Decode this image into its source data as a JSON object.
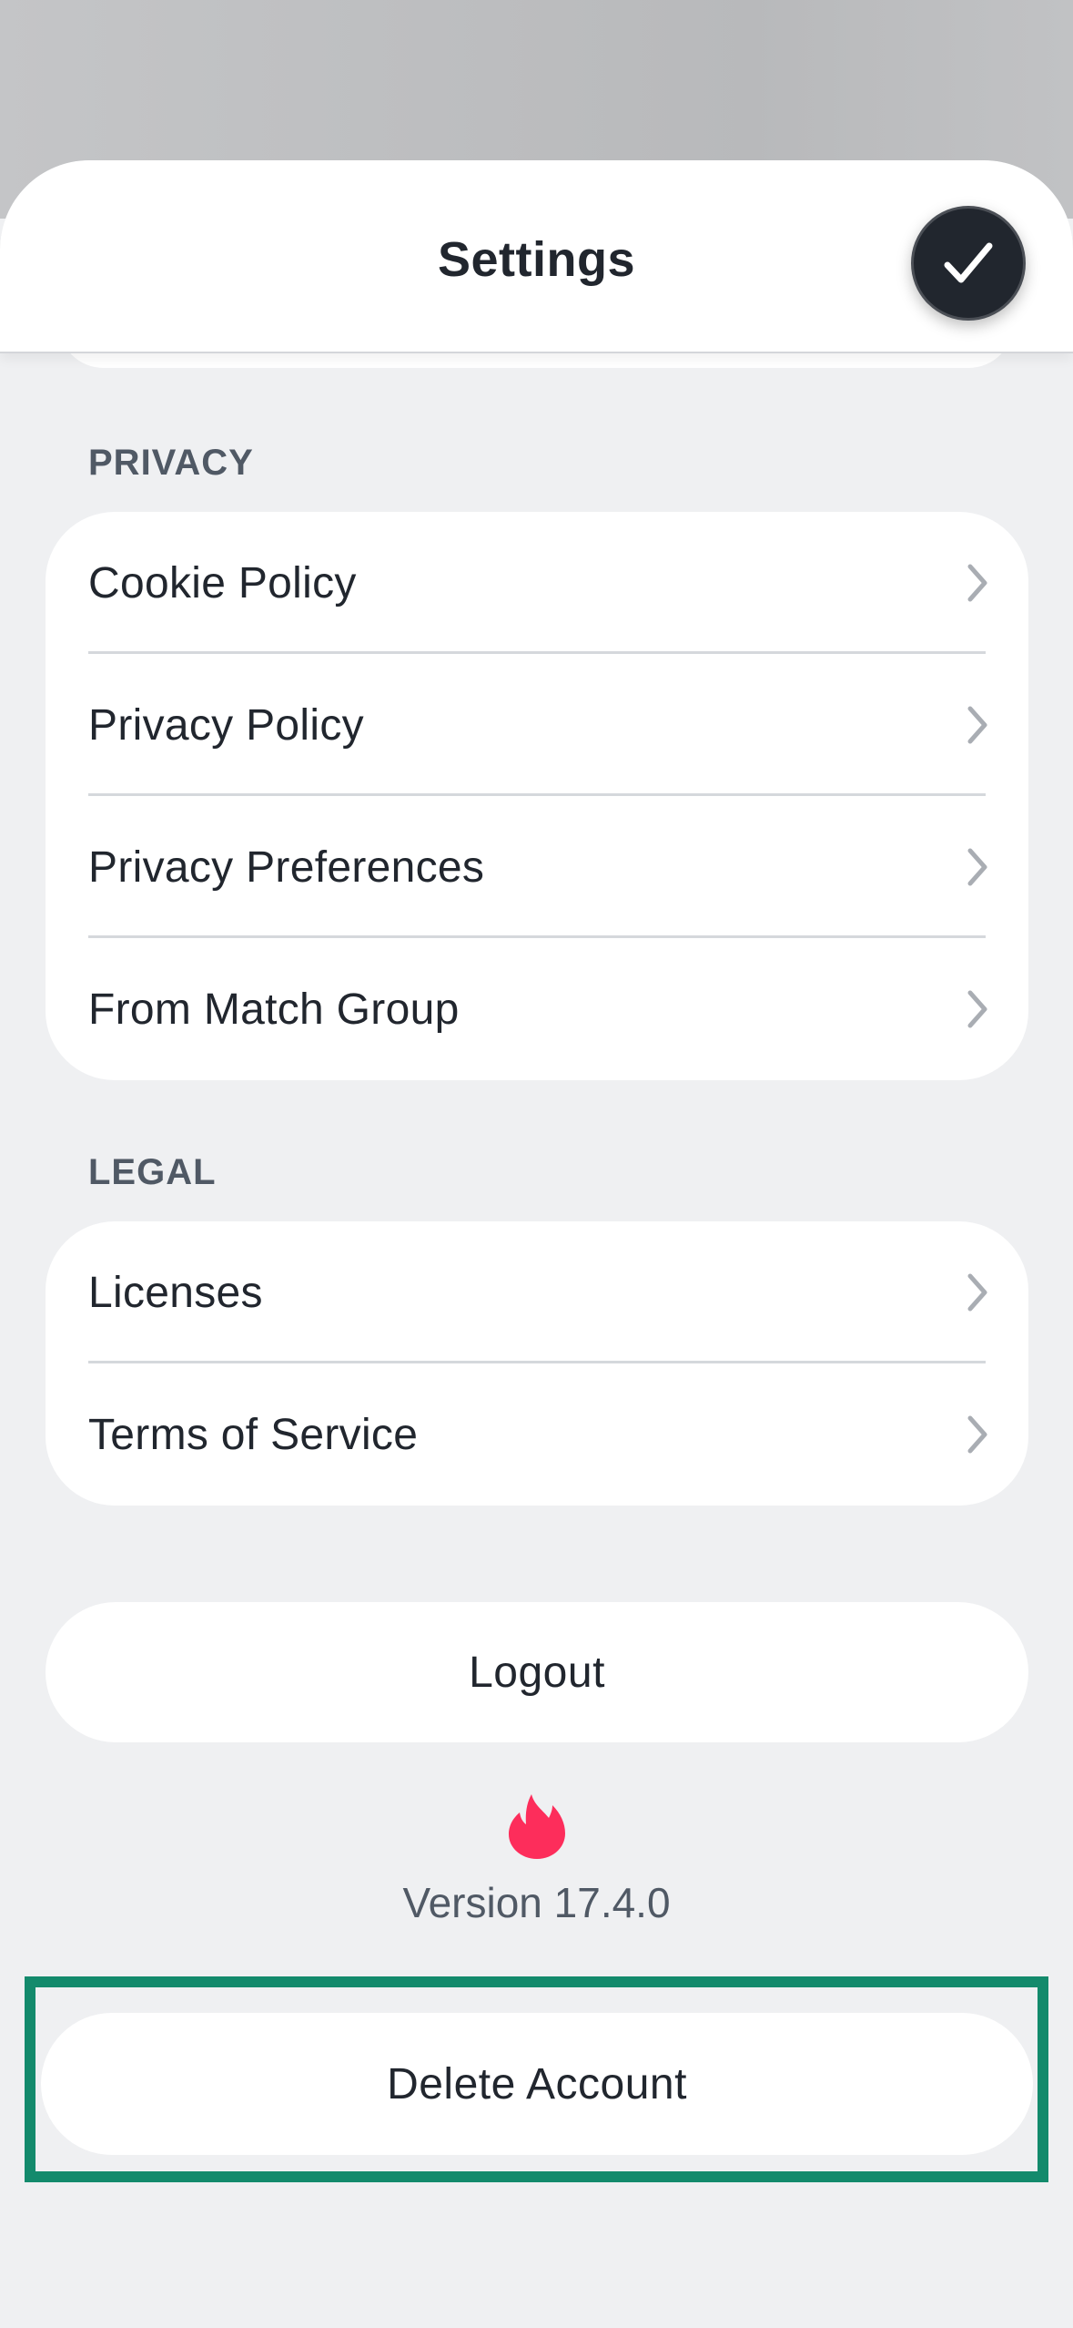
{
  "header": {
    "title": "Settings",
    "done_icon": "checkmark-icon"
  },
  "privacy": {
    "section_label": "PRIVACY",
    "items": [
      {
        "label": "Cookie Policy",
        "icon": "chevron-right-icon"
      },
      {
        "label": "Privacy Policy",
        "icon": "chevron-right-icon"
      },
      {
        "label": "Privacy Preferences",
        "icon": "chevron-right-icon"
      },
      {
        "label": "From Match Group",
        "icon": "chevron-right-icon"
      }
    ]
  },
  "legal": {
    "section_label": "LEGAL",
    "items": [
      {
        "label": "Licenses",
        "icon": "chevron-right-icon"
      },
      {
        "label": "Terms of Service",
        "icon": "chevron-right-icon"
      }
    ]
  },
  "logout_label": "Logout",
  "footer": {
    "logo_icon": "tinder-flame-icon",
    "version": "Version 17.4.0"
  },
  "delete_account_label": "Delete Account",
  "colors": {
    "accent": "#fd2d5b",
    "highlight": "#138a6c",
    "background": "#eff0f2",
    "text": "#21262e",
    "secondary_text": "#505965"
  }
}
